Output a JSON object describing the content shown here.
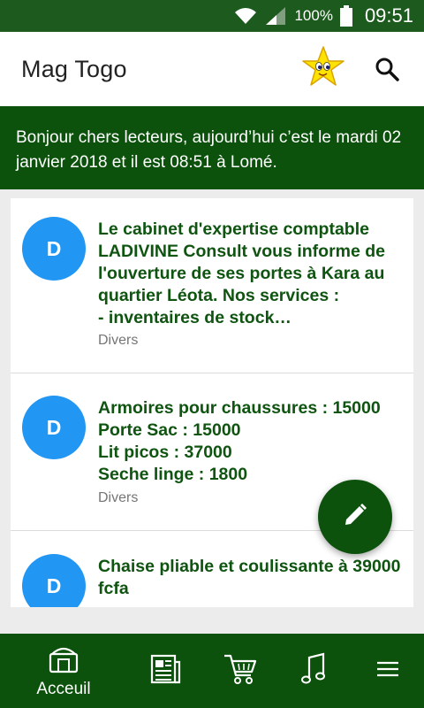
{
  "status_bar": {
    "battery": "100%",
    "time": "09:51"
  },
  "app_bar": {
    "title": "Mag Togo"
  },
  "banner": {
    "text": "Bonjour chers lecteurs, aujourd’hui c’est le mardi 02 janvier 2018 et il est 08:51 à Lomé."
  },
  "feed": {
    "items": [
      {
        "avatar": "D",
        "title": "Le cabinet d'expertise comptable LADIVINE Consult vous informe de l'ouverture de ses portes à Kara au quartier Léota. Nos services :\n- inventaires de stock…",
        "category": "Divers"
      },
      {
        "avatar": "D",
        "title": "Armoires pour chaussures : 15000\nPorte Sac : 15000\nLit picos : 37000\nSeche linge : 1800",
        "category": "Divers"
      },
      {
        "avatar": "D",
        "title": "Chaise pliable et coulissante à 39000 fcfa",
        "category": ""
      }
    ]
  },
  "bottom_nav": {
    "home_label": "Acceuil",
    "icons": [
      "home-icon",
      "newspaper-icon",
      "cart-icon",
      "music-icon",
      "menu-icon"
    ]
  },
  "colors": {
    "status_bar": "#1c5a1d",
    "brand_green": "#0c520c",
    "title_green": "#0f5410",
    "avatar_blue": "#2196f3"
  }
}
